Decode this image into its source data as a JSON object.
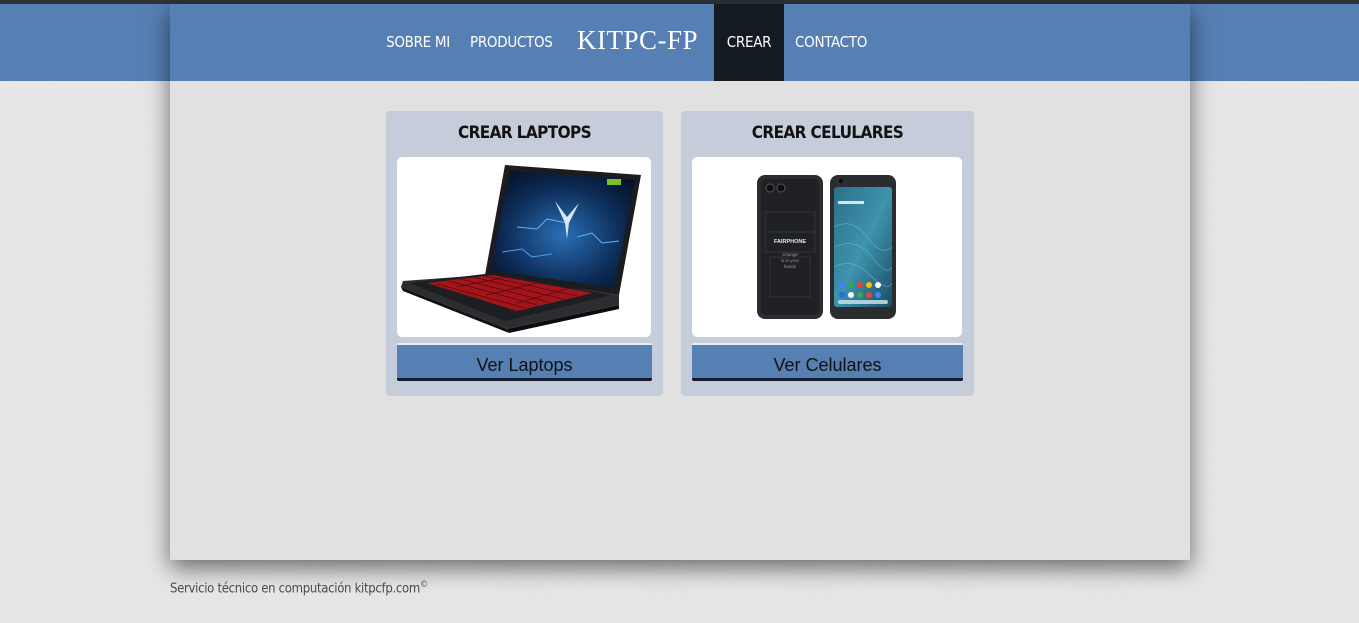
{
  "nav": {
    "items": [
      "SOBRE MI",
      "PRODUCTOS",
      "KITPC-FP",
      "CREAR",
      "CONTACTO"
    ]
  },
  "cards": [
    {
      "title": "CREAR LAPTOPS",
      "button": "Ver Laptops"
    },
    {
      "title": "CREAR CELULARES",
      "button": "Ver Celulares"
    }
  ],
  "phone": {
    "brand": "FAIRPHONE",
    "slogan": "Change\nis in your\nhands"
  },
  "footer": {
    "text": "Servicio técnico en computación kitpcfp.com",
    "symbol": "©"
  },
  "colors": {
    "nav": "#567fb3",
    "active": "#131a22",
    "card": "#c4cdd9",
    "button": "#567fb3"
  }
}
